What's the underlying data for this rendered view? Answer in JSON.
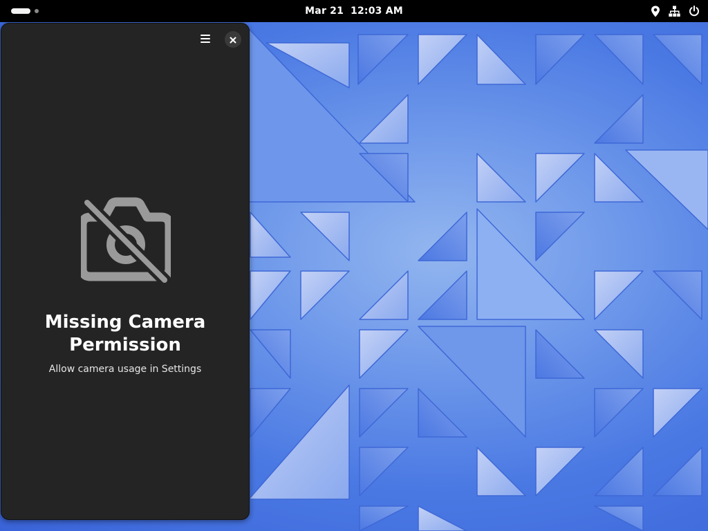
{
  "topbar": {
    "date": "Mar 21",
    "time": "12:03 AM",
    "icons": [
      "location-icon",
      "network-icon",
      "power-icon"
    ]
  },
  "window": {
    "menu_icon": "hamburger-menu-icon",
    "close_icon": "close-icon",
    "status": {
      "icon": "camera-disabled-icon",
      "title": "Missing Camera\nPermission",
      "description": "Allow camera usage in Settings"
    }
  },
  "colors": {
    "window_bg": "#242424",
    "topbar_bg": "#000000",
    "wallpaper_accent": "#4a79e3",
    "icon_gray": "#9a9a9a"
  }
}
